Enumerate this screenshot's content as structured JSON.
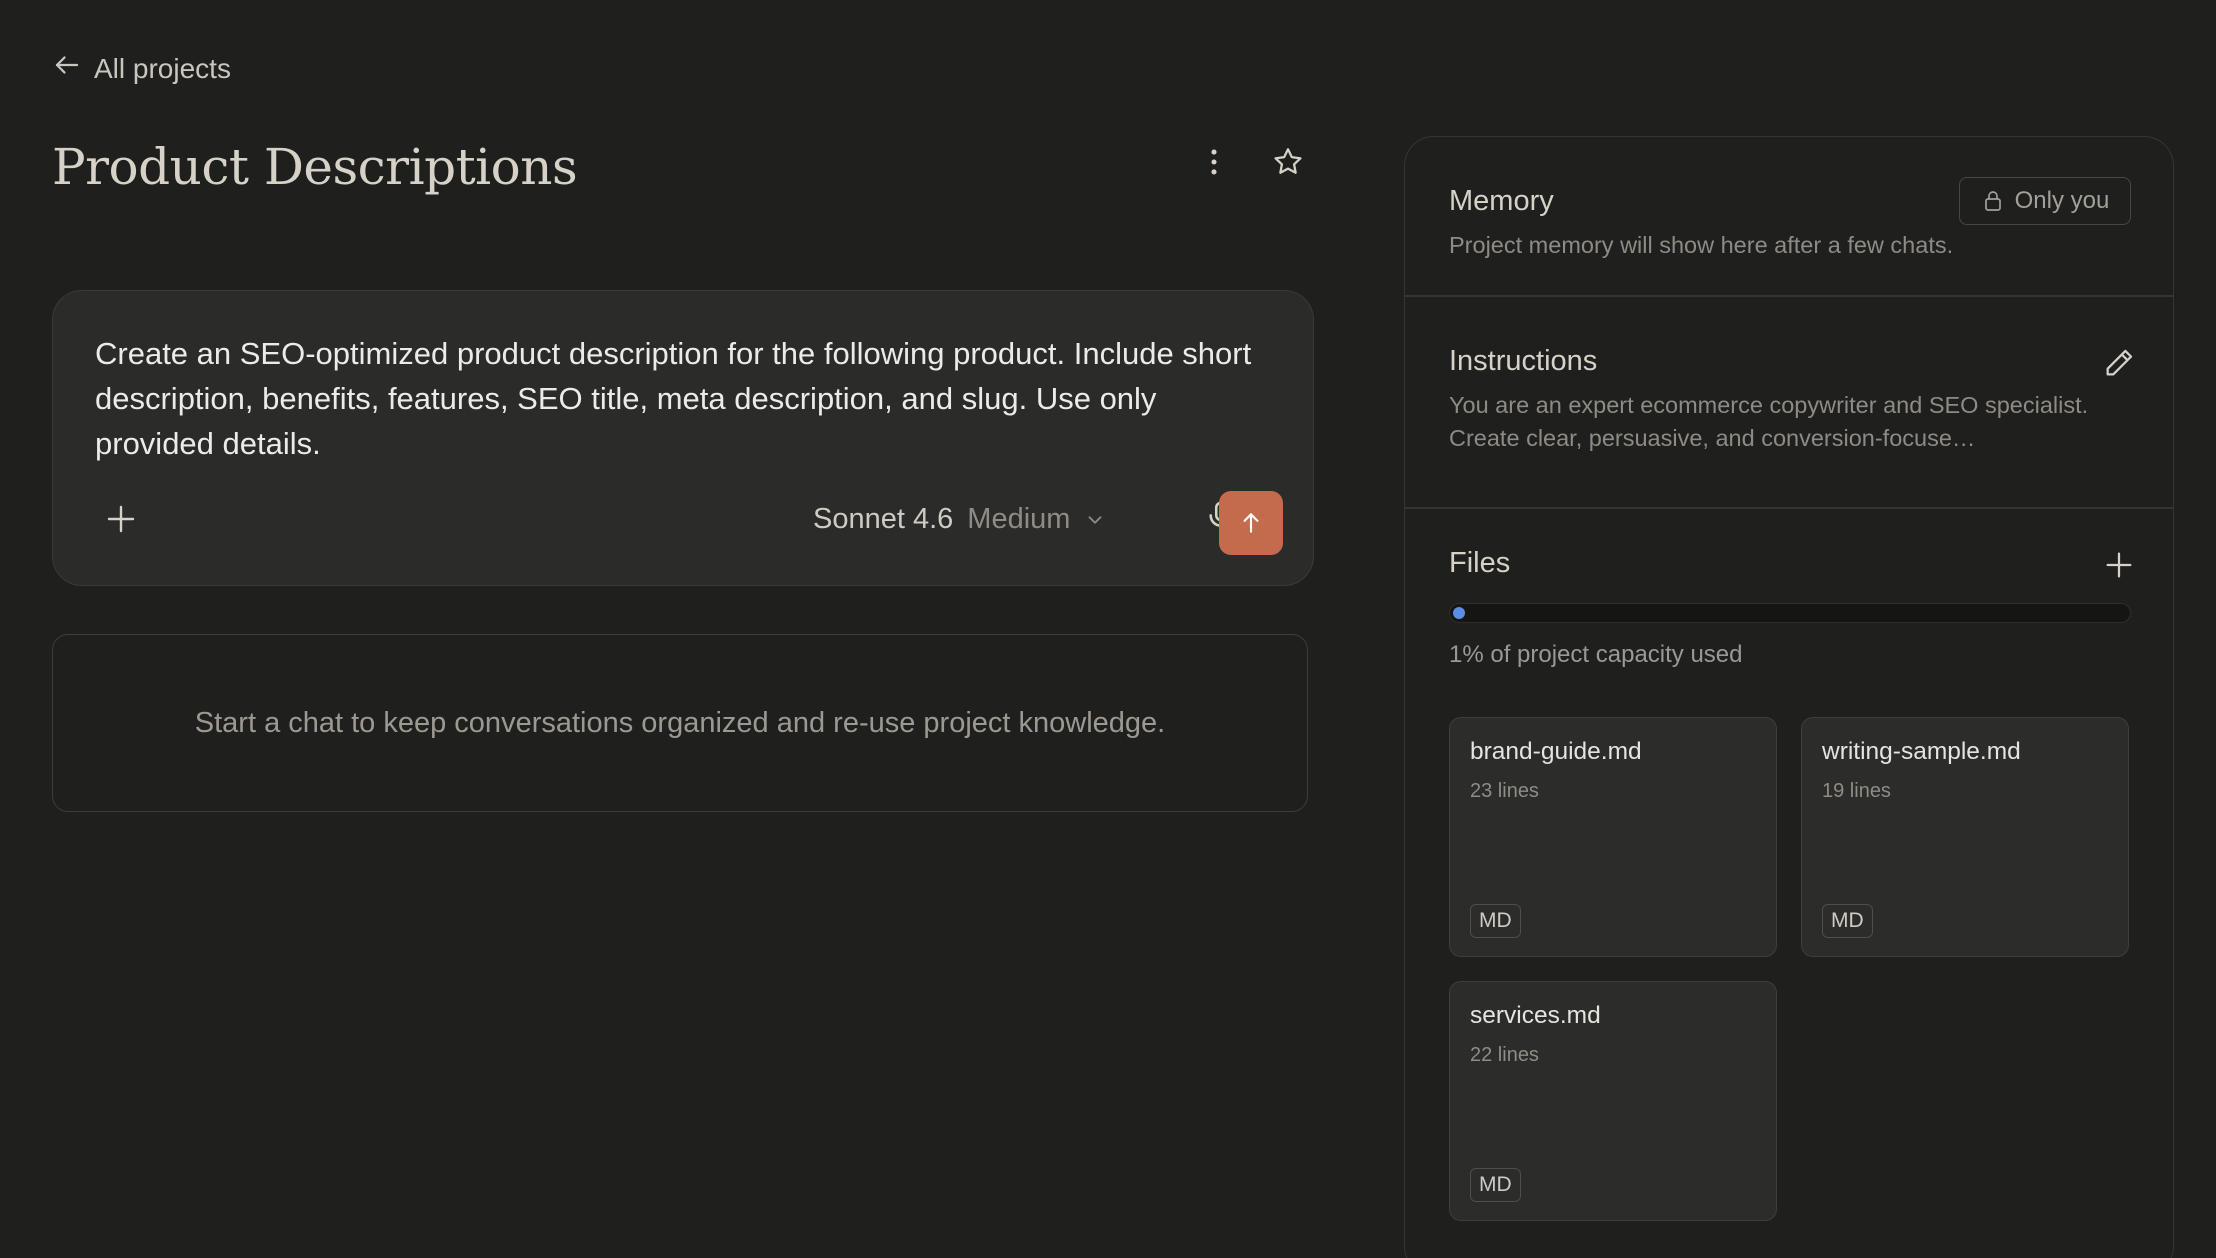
{
  "nav": {
    "back_label": "All projects"
  },
  "project": {
    "title": "Product Descriptions"
  },
  "composer": {
    "text": "Create an SEO-optimized product description for the following product. Include short description, benefits, features, SEO title, meta description, and slug. Use only provided details.",
    "model_name": "Sonnet 4.6",
    "model_level": "Medium"
  },
  "empty_state": {
    "text": "Start a chat to keep conversations organized and re-use project knowledge."
  },
  "memory": {
    "title": "Memory",
    "visibility": "Only you",
    "description": "Project memory will show here after a few chats."
  },
  "instructions": {
    "title": "Instructions",
    "description": "You are an expert ecommerce copywriter and SEO specialist. Create clear, persuasive, and conversion-focuse…"
  },
  "files": {
    "title": "Files",
    "capacity_percent": 1,
    "capacity_text": "1% of project capacity used",
    "items": [
      {
        "name": "brand-guide.md",
        "lines": "23 lines",
        "type": "MD"
      },
      {
        "name": "writing-sample.md",
        "lines": "19 lines",
        "type": "MD"
      },
      {
        "name": "services.md",
        "lines": "22 lines",
        "type": "MD"
      }
    ]
  },
  "colors": {
    "background": "#1f1f1e",
    "accent": "#c46a4d",
    "capacity": "#5b8de6"
  }
}
